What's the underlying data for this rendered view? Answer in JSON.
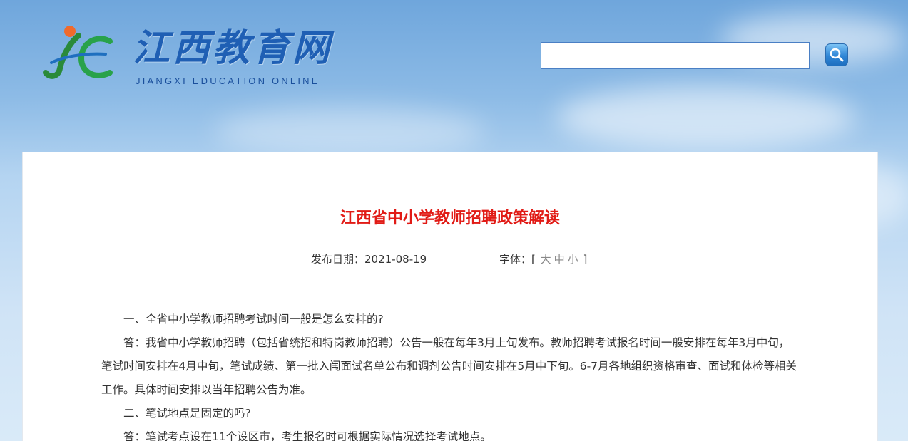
{
  "brand": {
    "name_cn": "江西教育网",
    "name_en": "JIANGXI  EDUCATION  ONLINE"
  },
  "search": {
    "placeholder": "",
    "value": "",
    "button_icon": "search-icon"
  },
  "article": {
    "title": "江西省中小学教师招聘政策解读",
    "date_label": "发布日期：",
    "date": "2021-08-19",
    "font_label": "字体：[",
    "font_close": "]",
    "font_sizes": [
      "大",
      "中",
      "小"
    ],
    "paragraphs": [
      "一、全省中小学教师招聘考试时间一般是怎么安排的?",
      "答：我省中小学教师招聘（包括省统招和特岗教师招聘）公告一般在每年3月上旬发布。教师招聘考试报名时间一般安排在每年3月中旬，笔试时间安排在4月中旬，笔试成绩、第一批入闱面试名单公布和调剂公告时间安排在5月中下旬。6-7月各地组织资格审查、面试和体检等相关工作。具体时间安排以当年招聘公告为准。",
      "二、笔试地点是固定的吗?",
      "答：笔试考点设在11个设区市，考生报名时可根据实际情况选择考试地点。"
    ]
  },
  "colors": {
    "title": "#e11b16",
    "brand": "#1f5fb4",
    "search_button": "#2f86d6"
  }
}
